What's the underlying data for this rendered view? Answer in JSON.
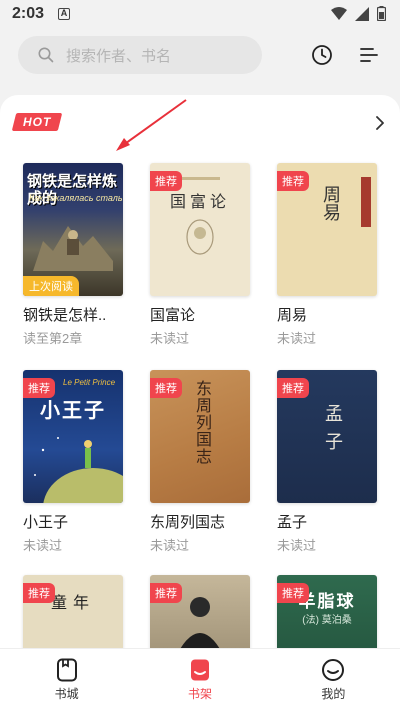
{
  "status": {
    "time": "2:03",
    "notif": "A"
  },
  "search": {
    "placeholder": "搜索作者、书名"
  },
  "hot_badge": "HOT",
  "books": [
    {
      "title": "钢铁是怎样..",
      "status": "读至第2章",
      "tag": "上次阅读",
      "cover_text": "钢铁是怎样炼成的",
      "cover_sub": "Как закалялась сталь"
    },
    {
      "title": "国富论",
      "status": "未读过",
      "tag": "推荐",
      "cover_text": "国富论"
    },
    {
      "title": "周易",
      "status": "未读过",
      "tag": "推荐",
      "cover_text": "周易"
    },
    {
      "title": "小王子",
      "status": "未读过",
      "tag": "推荐",
      "cover_text": "小王子",
      "cover_sub": "Le Petit Prince"
    },
    {
      "title": "东周列国志",
      "status": "未读过",
      "tag": "推荐",
      "cover_text": "东周列国志"
    },
    {
      "title": "孟子",
      "status": "未读过",
      "tag": "推荐",
      "cover_text": "孟子"
    },
    {
      "tag": "推荐",
      "cover_text": "童年"
    },
    {
      "tag": "推荐"
    },
    {
      "tag": "推荐",
      "cover_text": "羊脂球",
      "cover_sub": "(法) 莫泊桑"
    }
  ],
  "nav": [
    {
      "label": "书城"
    },
    {
      "label": "书架"
    },
    {
      "label": "我的"
    }
  ],
  "colors": {
    "accent": "#f0454d",
    "last_read": "#f6b82b"
  }
}
